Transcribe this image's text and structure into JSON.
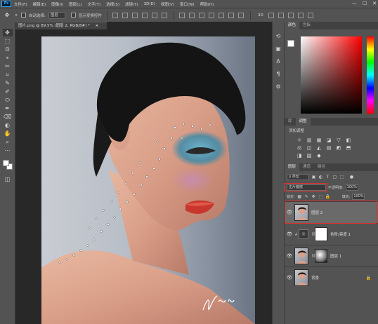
{
  "menu": {
    "logo": "Ps",
    "items": [
      "文件(F)",
      "编辑(E)",
      "图像(I)",
      "图层(L)",
      "文字(Y)",
      "选择(S)",
      "滤镜(T)",
      "3D(D)",
      "视图(V)",
      "窗口(W)",
      "帮助(H)"
    ],
    "win_min": "—",
    "win_max": "☐",
    "win_close": "✕"
  },
  "options": {
    "auto_select_label": "自动选择:",
    "auto_select_value": "图层",
    "show_transform_label": "显示变换控件"
  },
  "document": {
    "tab_title": "图片.png @ 89.5% (图层 2, RGB/8#) *",
    "close": "×"
  },
  "tools": [
    "✥",
    "⬚",
    "ʘ",
    "⌖",
    "✂",
    "⌗",
    "✎",
    "✐",
    "⬭",
    "✒",
    "⌫",
    "◐",
    "✋",
    "⌕",
    "⋯"
  ],
  "right_strip": [
    "⟲",
    "▣",
    "A",
    "¶",
    "⚙"
  ],
  "color_panel": {
    "tabs": [
      "颜色",
      "色板"
    ],
    "fg_color": "#ffffff"
  },
  "adjustments": {
    "tabs": [
      "库",
      "调整"
    ],
    "title": "添加调整",
    "icons": [
      "☼",
      "▥",
      "▦",
      "◪",
      "▽",
      "◧",
      "⚖",
      "◫",
      "◭",
      "▤",
      "◩",
      "⬒",
      "◨",
      "▧",
      "◆"
    ]
  },
  "layers_panel": {
    "tabs": [
      "图层",
      "通道",
      "路径"
    ],
    "filter_kind": "ρ 类型",
    "blend_mode": "正片叠底",
    "opacity_label": "不透明度:",
    "opacity_value": "100%",
    "lock_label": "锁定:",
    "fill_label": "填充:",
    "fill_value": "100%",
    "layers": [
      {
        "name": "图层 2",
        "visible": true,
        "selected": true
      },
      {
        "name": "色阶/亮度 1",
        "visible": true,
        "selected": false
      },
      {
        "name": "图层 1",
        "visible": true,
        "selected": false
      },
      {
        "name": "背景",
        "visible": true,
        "selected": false
      }
    ],
    "lock_icon": "🔒"
  },
  "photo": {
    "signature": "yu"
  },
  "colors": {
    "accent_red": "#e0302c",
    "panel_bg": "#535353"
  }
}
